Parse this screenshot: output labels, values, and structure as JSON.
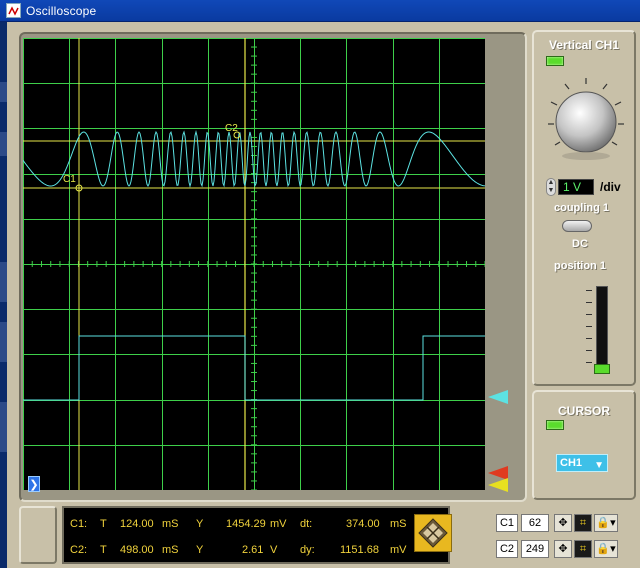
{
  "window": {
    "title": "Oscilloscope"
  },
  "vertical": {
    "title": "Vertical CH1",
    "volts_per_div_value": "1 V",
    "volts_per_div_unit": "/div",
    "coupling_label": "coupling 1",
    "coupling_value": "DC",
    "position_label": "position 1"
  },
  "cursor_panel": {
    "title": "CURSOR",
    "channel_selected": "CH1"
  },
  "screen": {
    "marker_c1": "C1",
    "marker_c2": "C2"
  },
  "readout": {
    "c1": {
      "label": "C1:",
      "t_label": "T",
      "t_value": "124.00",
      "t_unit": "mS",
      "y_label": "Y",
      "y_value": "1454.29",
      "y_unit": "mV",
      "d_label": "dt:",
      "d_value": "374.00",
      "d_unit": "mS"
    },
    "c2": {
      "label": "C2:",
      "t_label": "T",
      "t_value": "498.00",
      "t_unit": "mS",
      "y_label": "Y",
      "y_value": "2.61",
      "y_unit": "V",
      "d_label": "dy:",
      "d_value": "1151.68",
      "d_unit": "mV"
    }
  },
  "cursor_controls": [
    {
      "label": "C1",
      "value": "62"
    },
    {
      "label": "C2",
      "value": "249"
    }
  ],
  "colors": {
    "grid": "#3ecf4a",
    "cursor_line": "#e8e84a",
    "trace": "#5ce2e2",
    "readout_text": "#f0d23c"
  }
}
